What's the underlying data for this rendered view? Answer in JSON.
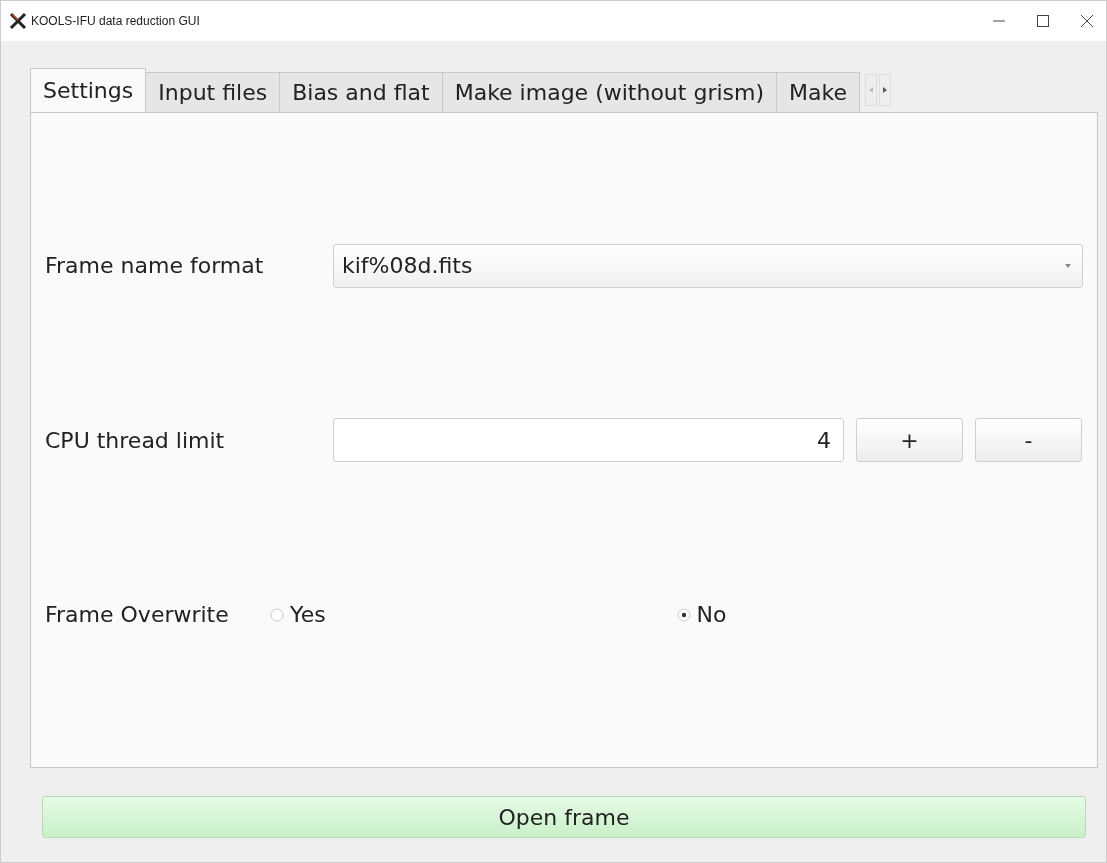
{
  "window": {
    "title": "KOOLS-IFU data reduction GUI"
  },
  "tabs": [
    {
      "label": "Settings",
      "selected": true
    },
    {
      "label": "Input files",
      "selected": false
    },
    {
      "label": "Bias and flat",
      "selected": false
    },
    {
      "label": "Make image (without grism)",
      "selected": false
    },
    {
      "label": "Make",
      "selected": false
    }
  ],
  "settings": [
    {
      "kind": "combo",
      "label": "Frame name format",
      "value": "kif%08d.fits"
    },
    {
      "kind": "spin",
      "label": "CPU thread limit",
      "value": "4",
      "buttons": [
        "+",
        "-"
      ]
    },
    {
      "kind": "radio",
      "label": "Frame Overwrite",
      "options": [
        {
          "label": "Yes",
          "selected": false
        },
        {
          "label": "No",
          "selected": true
        }
      ]
    }
  ],
  "action_button": "Open frame"
}
